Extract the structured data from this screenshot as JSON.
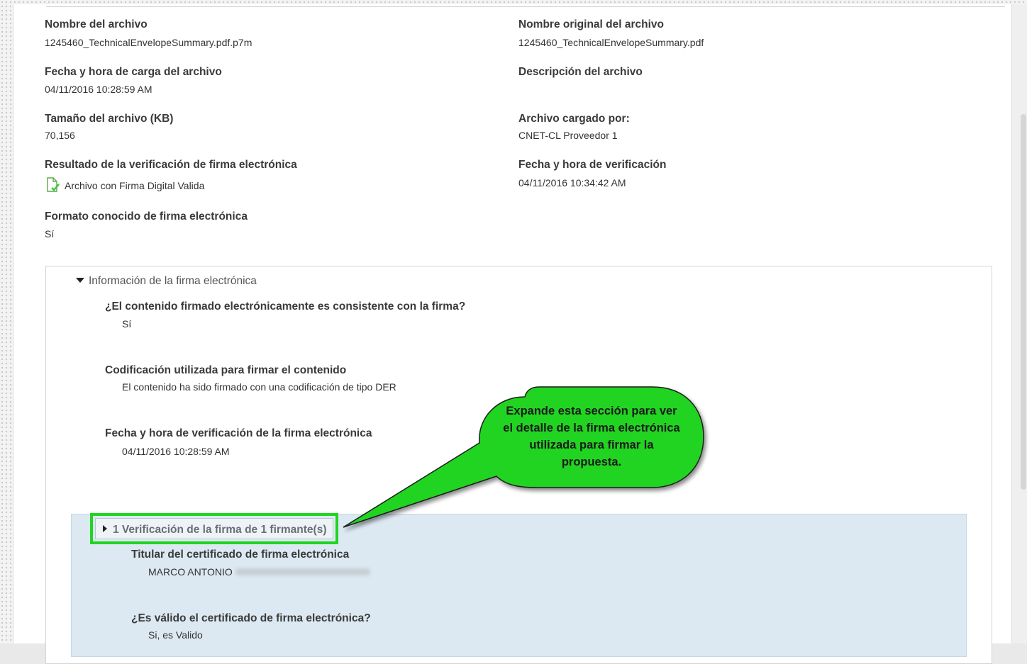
{
  "fields": {
    "file_name": {
      "label": "Nombre del archivo",
      "value": "1245460_TechnicalEnvelopeSummary.pdf.p7m"
    },
    "original_name": {
      "label": "Nombre original del archivo",
      "value": "1245460_TechnicalEnvelopeSummary.pdf"
    },
    "upload_datetime": {
      "label": "Fecha y hora de carga del archivo",
      "value": "04/11/2016 10:28:59 AM"
    },
    "description": {
      "label": "Descripción del archivo",
      "value": ""
    },
    "size": {
      "label": "Tamaño del archivo (KB)",
      "value": "70,156"
    },
    "uploaded_by": {
      "label": "Archivo cargado por:",
      "value": "CNET-CL Proveedor 1"
    },
    "verification_result": {
      "label": "Resultado de la verificación de firma electrónica",
      "value": "Archivo con Firma Digital Valida",
      "icon": "signed-document-icon"
    },
    "verification_datetime": {
      "label": "Fecha y hora de verificación",
      "value": "04/11/2016 10:34:42 AM"
    },
    "known_format": {
      "label": "Formato conocido de firma electrónica",
      "value": "Sí"
    }
  },
  "signature_section": {
    "header": "Información de la firma electrónica",
    "items": [
      {
        "label": "¿El contenido firmado electrónicamente es consistente con la firma?",
        "value": "Sí"
      },
      {
        "label": "Codificación utilizada para firmar el contenido",
        "value": "El contenido ha sido firmado con una codificación de tipo DER"
      },
      {
        "label": "Fecha y hora de verificación de la firma electrónica",
        "value": "04/11/2016 10:28:59 AM"
      }
    ],
    "signers": {
      "header": "1 Verificación de la firma de 1 firmante(s)",
      "items": [
        {
          "label": "Titular del certificado de firma electrónica",
          "value": "MARCO ANTONIO"
        },
        {
          "label": "¿Es válido el certificado de firma electrónica?",
          "value": "Si, es Valido"
        }
      ]
    }
  },
  "callout": {
    "text": "Expande esta sección para ver el detalle de la firma electrónica utilizada para firmar la propuesta.",
    "color": "#21d421"
  }
}
